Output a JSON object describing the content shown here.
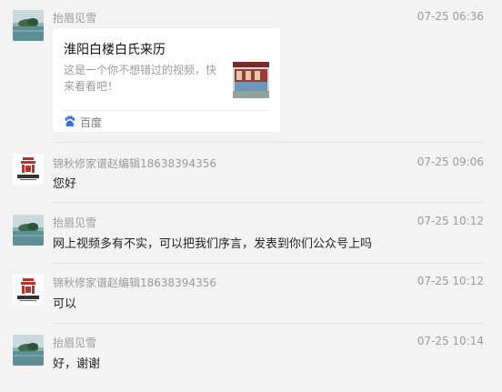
{
  "messages": [
    {
      "sender": "抬眉见雪",
      "time": "07-25 06:36",
      "avatar_icon": "lake-landscape-avatar",
      "card": {
        "title": "淮阳白楼白氏来历",
        "desc_line1": "这是一个你不想错过的视频，快",
        "desc_line2": "来看看吧！",
        "source": "百度",
        "source_icon": "baidu-paw-icon"
      }
    },
    {
      "sender": "锦秋修家谱赵编辑18638394356",
      "time": "07-25 09:06",
      "avatar_icon": "jinqiu-logo-avatar",
      "text": "您好"
    },
    {
      "sender": "抬眉见雪",
      "time": "07-25 10:12",
      "avatar_icon": "lake-landscape-avatar",
      "text": "网上视频多有不实，可以把我们序言，发表到你们公众号上吗"
    },
    {
      "sender": "锦秋修家谱赵编辑18638394356",
      "time": "07-25 10:12",
      "avatar_icon": "jinqiu-logo-avatar",
      "text": "可以"
    },
    {
      "sender": "抬眉见雪",
      "time": "07-25 10:14",
      "avatar_icon": "lake-landscape-avatar",
      "text": "好，谢谢"
    }
  ],
  "colors": {
    "background": "#f3f3f3",
    "card": "#ffffff",
    "meta_text": "#9a9a9a",
    "logo_red": "#b5342b",
    "baidu_blue": "#2f6fe0"
  }
}
